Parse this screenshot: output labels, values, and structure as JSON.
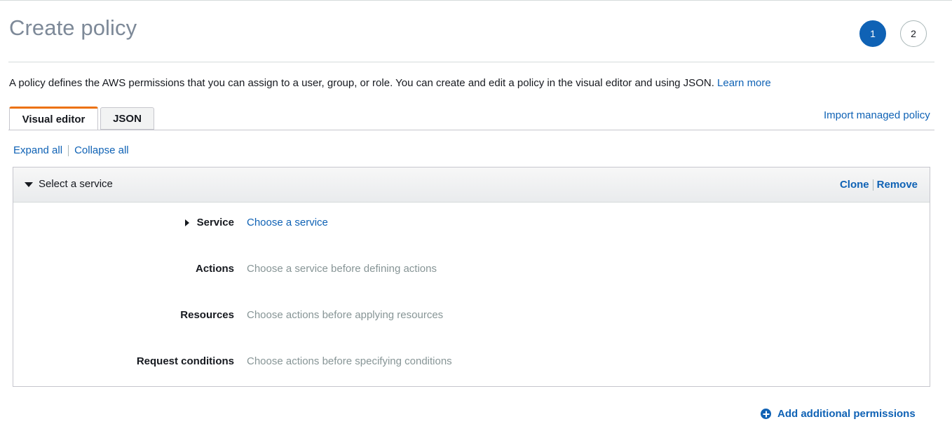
{
  "page": {
    "title": "Create policy",
    "steps": [
      "1",
      "2"
    ],
    "description": "A policy defines the AWS permissions that you can assign to a user, group, or role. You can create and edit a policy in the visual editor and using JSON.",
    "learn_more": "Learn more"
  },
  "tabs": [
    {
      "label": "Visual editor",
      "active": true
    },
    {
      "label": "JSON",
      "active": false
    }
  ],
  "import_link": "Import managed policy",
  "expand_all": "Expand all",
  "collapse_all": "Collapse all",
  "statement": {
    "title": "Select a service",
    "clone": "Clone",
    "remove": "Remove",
    "rows": [
      {
        "label": "Service",
        "value": "Choose a service"
      },
      {
        "label": "Actions",
        "value": "Choose a service before defining actions"
      },
      {
        "label": "Resources",
        "value": "Choose actions before applying resources"
      },
      {
        "label": "Request conditions",
        "value": "Choose actions before specifying conditions"
      }
    ]
  },
  "add_permissions": "Add additional permissions",
  "colors": {
    "accent": "#0f62b5",
    "tab_active_border": "#ec7211",
    "muted_text": "#879596"
  },
  "icons": [
    "caret-down-icon",
    "caret-right-icon",
    "plus-circle-icon"
  ]
}
